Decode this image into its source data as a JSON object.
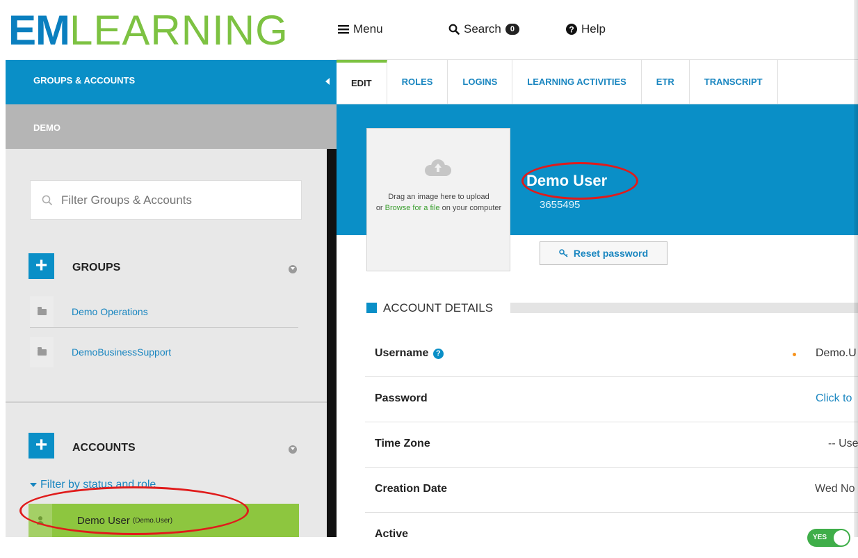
{
  "logo": {
    "part1": "EM",
    "part2": "LEARNING"
  },
  "topnav": {
    "menu": "Menu",
    "search": "Search",
    "search_count": "0",
    "help": "Help"
  },
  "sidebar": {
    "header": "GROUPS & ACCOUNTS",
    "subheader": "DEMO",
    "filter_placeholder": "Filter Groups & Accounts",
    "groups_title": "GROUPS",
    "groups": [
      "Demo Operations",
      "DemoBusinessSupport"
    ],
    "accounts_title": "ACCOUNTS",
    "filter_status": "Filter by status and role",
    "account": {
      "name": "Demo User",
      "username": "(Demo.User)"
    }
  },
  "tabs": [
    "EDIT",
    "ROLES",
    "LOGINS",
    "LEARNING ACTIVITIES",
    "ETR",
    "TRANSCRIPT"
  ],
  "profile": {
    "upload_line1": "Drag an image here to upload",
    "upload_line2_pre": "or ",
    "upload_link": "Browse for a file",
    "upload_line2_post": " on your computer",
    "name": "Demo User",
    "id": "3655495",
    "reset_button": "Reset password"
  },
  "account_details": {
    "title": "ACCOUNT DETAILS",
    "rows": [
      {
        "label": "Username",
        "value": "Demo.U"
      },
      {
        "label": "Password",
        "value": "Click to"
      },
      {
        "label": "Time Zone",
        "value": "-- Use s"
      },
      {
        "label": "Creation Date",
        "value": "Wed No"
      },
      {
        "label": "Active",
        "value": "YES"
      }
    ]
  },
  "colors": {
    "brand_blue": "#0a8fc7",
    "brand_green": "#7dc242",
    "link_blue": "#1a86c0",
    "highlight_red": "#e01b1b"
  }
}
